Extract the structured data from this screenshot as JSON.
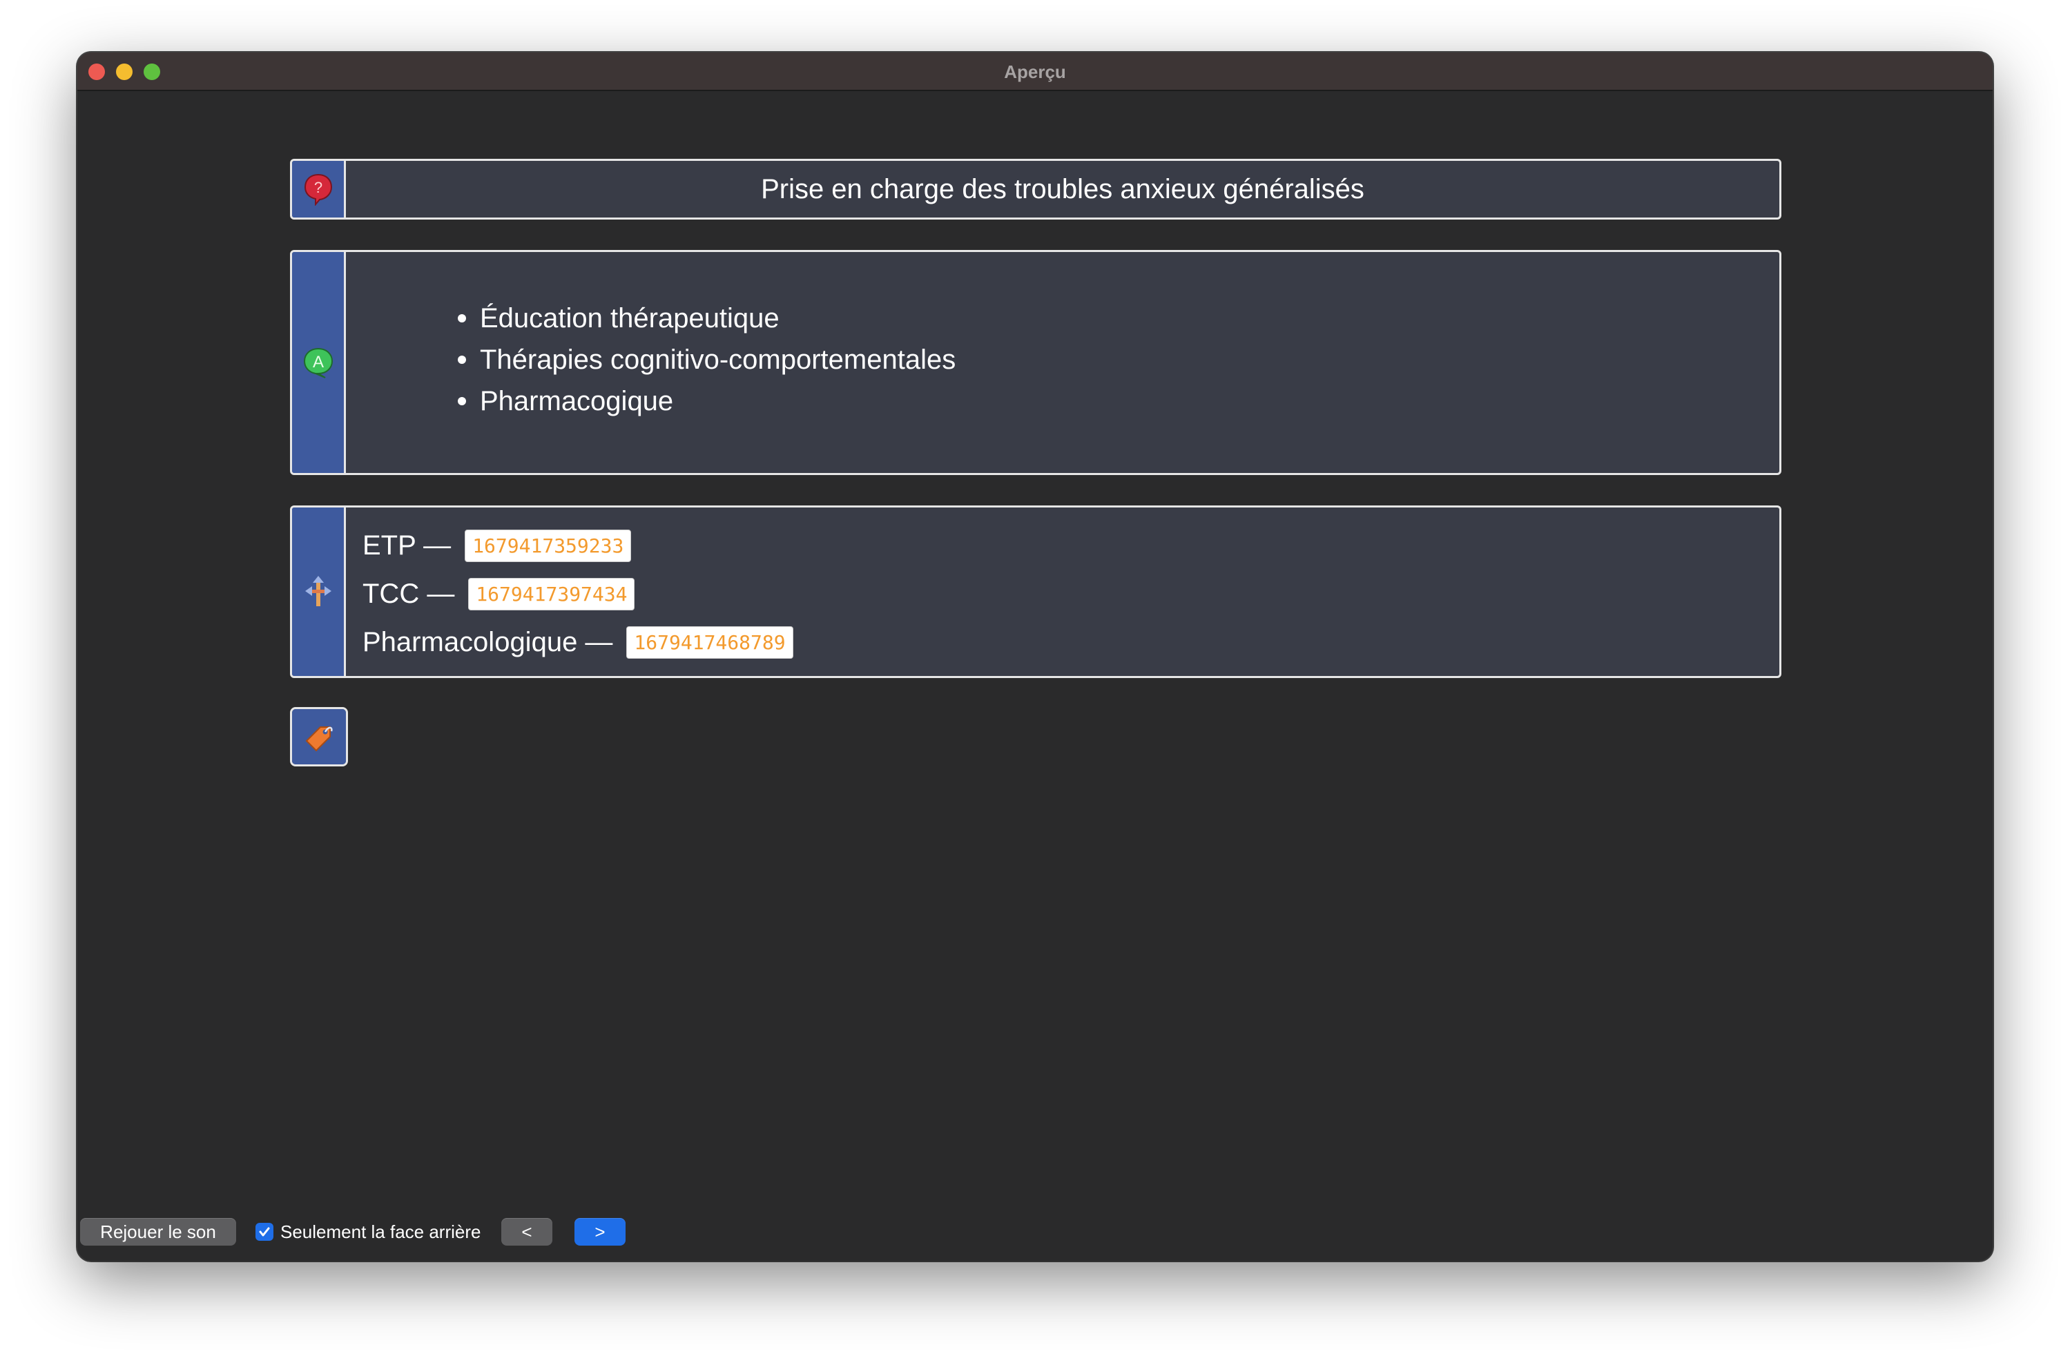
{
  "window": {
    "title": "Aperçu"
  },
  "cards": {
    "question": {
      "icon": "question-bubble-icon",
      "text": "Prise en charge des troubles anxieux généralisés"
    },
    "answer": {
      "icon": "answer-bubble-icon",
      "items": [
        "Éducation thérapeutique",
        "Thérapies cognitivo-comportementales",
        "Pharmacogique"
      ]
    },
    "links": {
      "icon": "signpost-icon",
      "rows": [
        {
          "label": "ETP —",
          "ref": "1679417359233"
        },
        {
          "label": "TCC —",
          "ref": "1679417397434"
        },
        {
          "label": "Pharmacologique —",
          "ref": "1679417468789"
        }
      ]
    },
    "tags": {
      "icon": "tag-icon"
    }
  },
  "bottom": {
    "replay_label": "Rejouer le son",
    "only_back_label": "Seulement la face arrière",
    "only_back_checked": true,
    "prev_label": "<",
    "next_label": ">"
  },
  "colors": {
    "side_panel": "#3e5a9e",
    "card_bg": "#393c47",
    "ref_text": "#f39a2d",
    "accent_button": "#1f6ee8"
  }
}
